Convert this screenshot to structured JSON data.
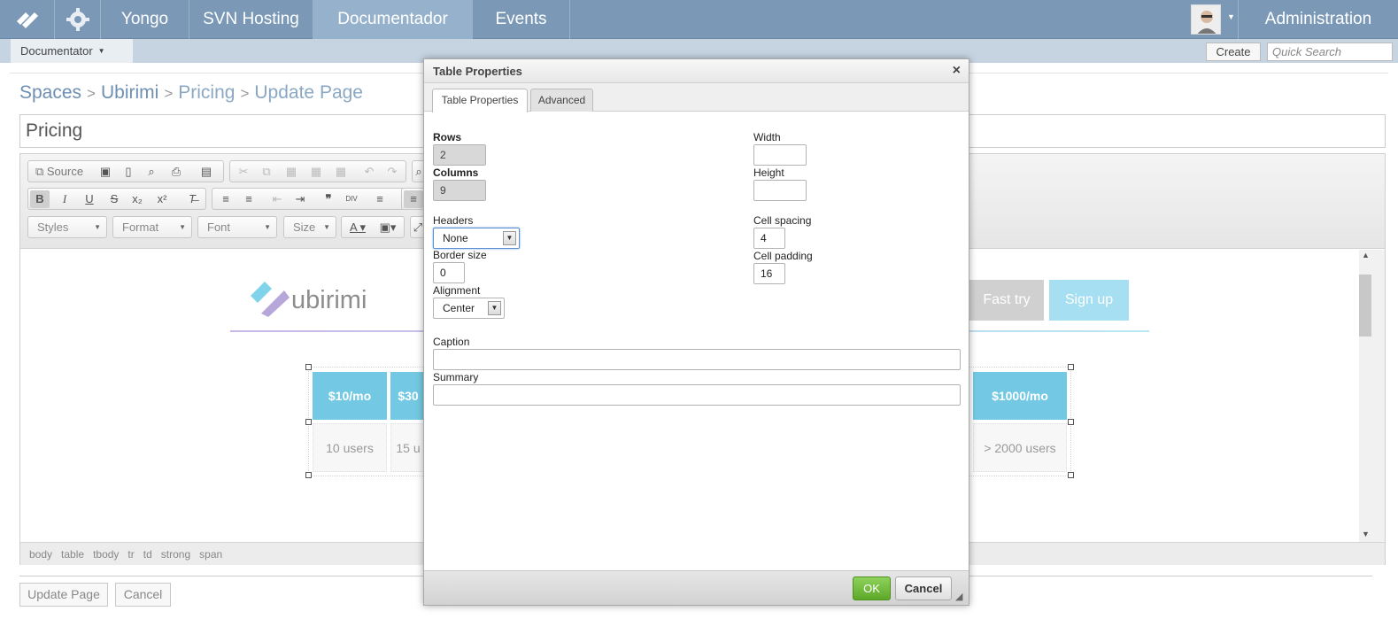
{
  "nav": {
    "tabs": [
      "Yongo",
      "SVN Hosting",
      "Documentador",
      "Events"
    ],
    "active": "Documentador",
    "admin_label": "Administration"
  },
  "subbar": {
    "space_menu": "Documentator",
    "create_label": "Create",
    "search_placeholder": "Quick Search"
  },
  "breadcrumb": {
    "items": [
      "Spaces",
      "Ubirimi",
      "Pricing",
      "Update Page"
    ],
    "separator": ">"
  },
  "page_title_value": "Pricing",
  "toolbar": {
    "source_label": "Source",
    "styles_label": "Styles",
    "format_label": "Format",
    "font_label": "Font",
    "size_label": "Size"
  },
  "content": {
    "logo_text": "ubirimi",
    "fast_try": "Fast try",
    "sign_up": "Sign up",
    "price_headers": [
      "$10/mo",
      "$30",
      "$1000/mo"
    ],
    "user_counts": [
      "10 users",
      "15 u",
      "> 2000 users"
    ]
  },
  "element_path": [
    "body",
    "table",
    "tbody",
    "tr",
    "td",
    "strong",
    "span"
  ],
  "actions": {
    "update_label": "Update Page",
    "cancel_label": "Cancel"
  },
  "dialog": {
    "title": "Table Properties",
    "close_glyph": "×",
    "tabs": [
      "Table Properties",
      "Advanced"
    ],
    "rows_label": "Rows",
    "rows_value": "2",
    "columns_label": "Columns",
    "columns_value": "9",
    "headers_label": "Headers",
    "headers_value": "None",
    "border_label": "Border size",
    "border_value": "0",
    "alignment_label": "Alignment",
    "alignment_value": "Center",
    "width_label": "Width",
    "width_value": "",
    "height_label": "Height",
    "height_value": "",
    "cellspacing_label": "Cell spacing",
    "cellspacing_value": "4",
    "cellpadding_label": "Cell padding",
    "cellpadding_value": "16",
    "caption_label": "Caption",
    "summary_label": "Summary",
    "ok_label": "OK",
    "cancel_label": "Cancel"
  },
  "colors": {
    "nav_bg": "#7b99b7",
    "accent_price": "#73c9e3",
    "ok_green": "#6cb83a"
  }
}
